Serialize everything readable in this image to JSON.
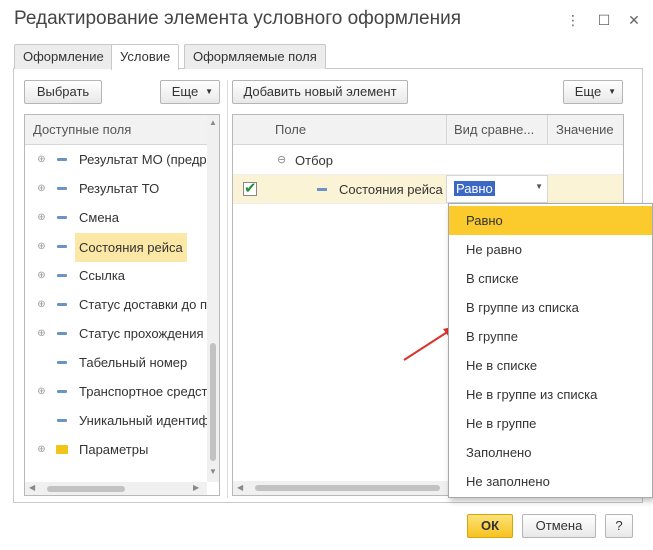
{
  "window": {
    "title": "Редактирование элемента условного оформления"
  },
  "tabs": [
    {
      "label": "Оформление",
      "active": false
    },
    {
      "label": "Условие",
      "active": true
    },
    {
      "label": "Оформляемые поля",
      "active": false
    }
  ],
  "left_panel": {
    "select_button": "Выбрать",
    "more_button": "Еще",
    "header": "Доступные поля",
    "items": [
      {
        "label": "Результат МО (предр",
        "expandable": true,
        "icon": "field-icon"
      },
      {
        "label": "Результат ТО",
        "expandable": true,
        "icon": "field-icon"
      },
      {
        "label": "Смена",
        "expandable": true,
        "icon": "field-icon"
      },
      {
        "label": "Состояния рейса",
        "expandable": true,
        "icon": "field-icon",
        "selected": true
      },
      {
        "label": "Ссылка",
        "expandable": true,
        "icon": "field-icon"
      },
      {
        "label": "Статус доставки до п",
        "expandable": true,
        "icon": "field-icon"
      },
      {
        "label": "Статус прохождения",
        "expandable": true,
        "icon": "field-icon"
      },
      {
        "label": "Табельный номер",
        "expandable": false,
        "icon": "field-icon"
      },
      {
        "label": "Транспортное средст",
        "expandable": true,
        "icon": "field-icon"
      },
      {
        "label": "Уникальный идентифи",
        "expandable": false,
        "icon": "field-icon"
      },
      {
        "label": "Параметры",
        "expandable": true,
        "icon": "folder-icon"
      }
    ]
  },
  "right_panel": {
    "add_button": "Добавить новый элемент",
    "more_button": "Еще",
    "columns": {
      "field": "Поле",
      "comparison": "Вид сравне...",
      "value": "Значение"
    },
    "group_label": "Отбор",
    "row": {
      "checked": true,
      "field": "Состояния рейса",
      "comparison": "Равно"
    }
  },
  "comparison_dropdown": {
    "options": [
      "Равно",
      "Не равно",
      "В списке",
      "В группе из списка",
      "В группе",
      "Не в списке",
      "Не в группе из списка",
      "Не в группе",
      "Заполнено",
      "Не заполнено"
    ],
    "selected": "Равно"
  },
  "footer": {
    "ok_button": "ОК",
    "cancel_button": "Отмена",
    "help_button": "?"
  },
  "colors": {
    "accent": "#fbcb2d",
    "selection": "#fbe7a6",
    "highlight": "#3b68c4",
    "arrow": "#d9342b",
    "check": "#1f8f3a"
  }
}
